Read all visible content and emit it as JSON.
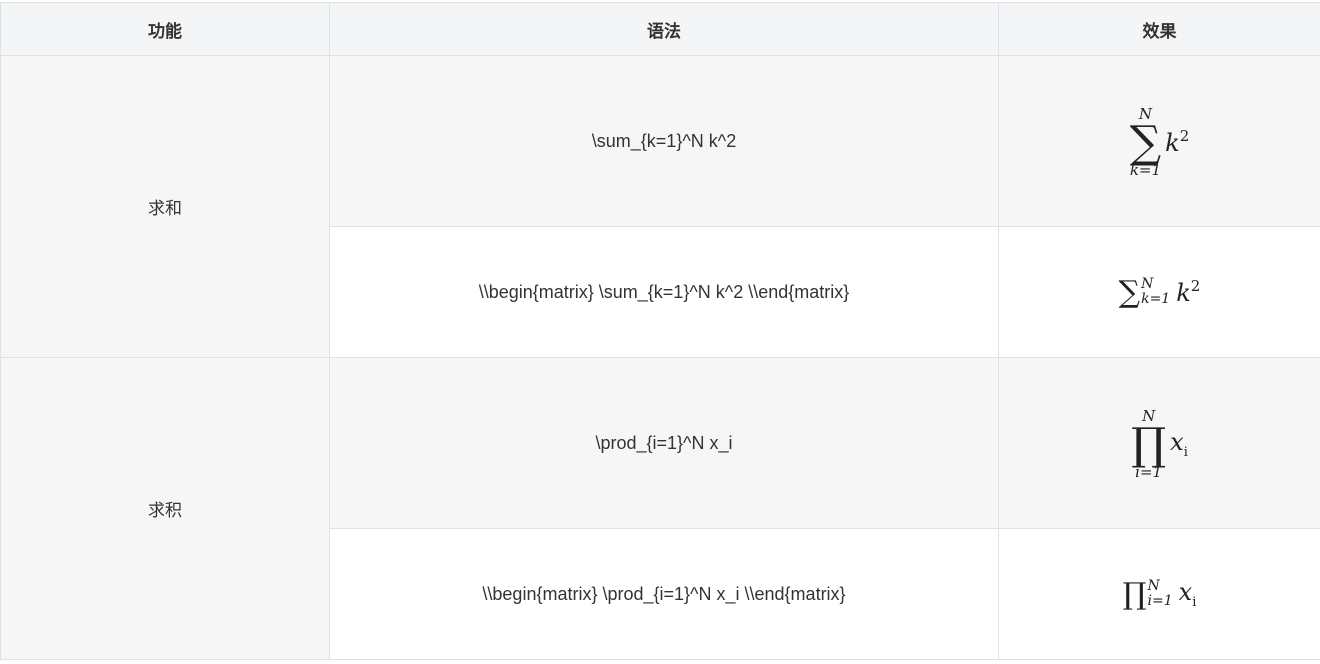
{
  "table": {
    "headers": {
      "feature": "功能",
      "syntax": "语法",
      "effect": "效果"
    },
    "groups": [
      {
        "feature": "求和",
        "rows": [
          {
            "syntax": "\\sum_{k=1}^N k^2",
            "effect": {
              "op": "∑",
              "upper": "N",
              "lower": "k=1",
              "term": "k",
              "sup": "2",
              "sub": ""
            }
          },
          {
            "syntax": "\\\\begin{matrix} \\sum_{k=1}^N k^2 \\\\end{matrix}",
            "effect": {
              "op": "∑",
              "upper": "N",
              "lower": "k=1",
              "term": "k",
              "sup": "2",
              "sub": ""
            }
          }
        ]
      },
      {
        "feature": "求积",
        "rows": [
          {
            "syntax": "\\prod_{i=1}^N x_i",
            "effect": {
              "op": "∏",
              "upper": "N",
              "lower": "i=1",
              "term": "x",
              "sup": "",
              "sub": "i"
            }
          },
          {
            "syntax": "\\\\begin{matrix} \\prod_{i=1}^N x_i \\\\end{matrix}",
            "effect": {
              "op": "∏",
              "upper": "N",
              "lower": "i=1",
              "term": "x",
              "sup": "",
              "sub": "i"
            }
          }
        ]
      }
    ]
  }
}
